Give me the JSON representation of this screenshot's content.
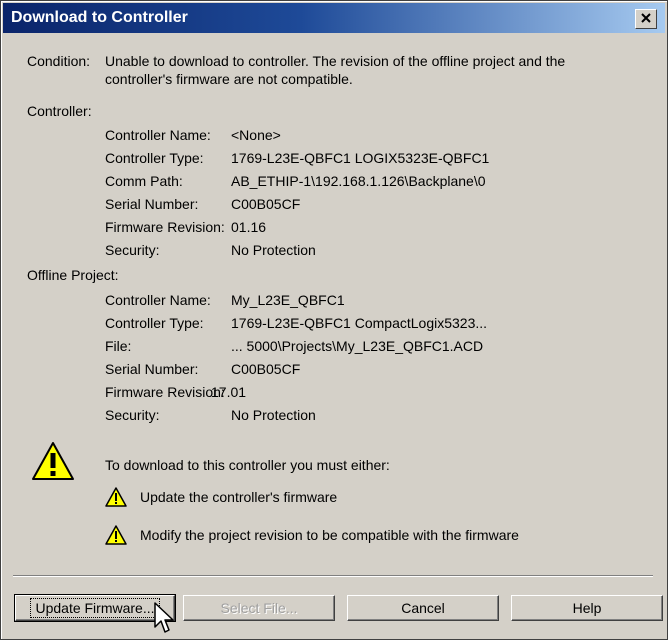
{
  "window": {
    "title": "Download to Controller"
  },
  "condition": {
    "label": "Condition:",
    "line1": "Unable to download to controller. The revision of the offline project and the",
    "line2": "controller's firmware are not compatible."
  },
  "controller": {
    "heading": "Controller:",
    "rows": [
      {
        "label": "Controller Name:",
        "value": "<None>"
      },
      {
        "label": "Controller Type:",
        "value": "1769-L23E-QBFC1 LOGIX5323E-QBFC1"
      },
      {
        "label": "Comm Path:",
        "value": "AB_ETHIP-1\\192.168.1.126\\Backplane\\0"
      },
      {
        "label": "Serial Number:",
        "value": "C00B05CF"
      },
      {
        "label": "Firmware Revision:",
        "value": "01.16"
      },
      {
        "label": "Security:",
        "value": "No Protection"
      }
    ]
  },
  "offline_project": {
    "heading": "Offline Project:",
    "rows": [
      {
        "label": "Controller Name:",
        "value": "My_L23E_QBFC1"
      },
      {
        "label": "Controller Type:",
        "value": "1769-L23E-QBFC1 CompactLogix5323..."
      },
      {
        "label": "File:",
        "value": "... 5000\\Projects\\My_L23E_QBFC1.ACD"
      },
      {
        "label": "Serial Number:",
        "value": "C00B05CF"
      },
      {
        "label": "Firmware Revision:",
        "value": "17.01"
      },
      {
        "label": "Security:",
        "value": "No Protection"
      }
    ]
  },
  "warning": {
    "intro": "To download to this controller you must either:",
    "option1": "Update the controller's firmware",
    "option2": "Modify the project revision to be compatible with the firmware"
  },
  "buttons": {
    "update_firmware": "Update Firmware...",
    "select_file": "Select File...",
    "cancel": "Cancel",
    "help": "Help"
  },
  "icons": {
    "title_close": "close-icon",
    "large_warning": "warning-icon",
    "small_warning": "warning-icon",
    "cursor": "mouse-cursor-icon"
  },
  "colors": {
    "title_gradient_start": "#0a246a",
    "title_gradient_end": "#a6caf0",
    "dialog_background": "#d4d0c8",
    "warning_yellow": "#ffff00"
  }
}
